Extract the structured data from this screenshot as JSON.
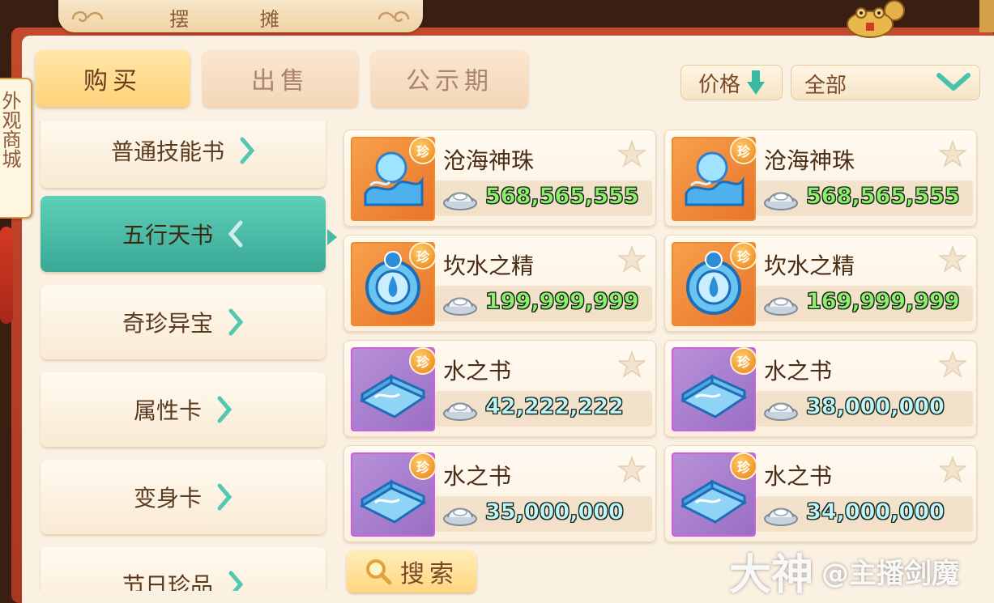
{
  "window": {
    "title": "摆 摊"
  },
  "side_tab": {
    "label": "外观商城"
  },
  "tabs": [
    {
      "label": "购买",
      "active": true
    },
    {
      "label": "出售",
      "active": false
    },
    {
      "label": "公示期",
      "active": false
    }
  ],
  "sort": {
    "label": "价格",
    "direction_icon": "arrow-down-icon"
  },
  "filter": {
    "selected": "全部"
  },
  "categories": [
    {
      "label": "普通技能书",
      "active": false
    },
    {
      "label": "五行天书",
      "active": true
    },
    {
      "label": "奇珍异宝",
      "active": false
    },
    {
      "label": "属性卡",
      "active": false
    },
    {
      "label": "变身卡",
      "active": false
    },
    {
      "label": "节日珍品",
      "active": false
    }
  ],
  "rare_badge": "珍",
  "items": [
    {
      "name": "沧海神珠",
      "price": "568,565,555",
      "icon": "water-orb-icon",
      "frame": "orange",
      "price_color": "green"
    },
    {
      "name": "沧海神珠",
      "price": "568,565,555",
      "icon": "water-orb-icon",
      "frame": "orange",
      "price_color": "green"
    },
    {
      "name": "坎水之精",
      "price": "199,999,999",
      "icon": "water-essence-icon",
      "frame": "orange",
      "price_color": "green"
    },
    {
      "name": "坎水之精",
      "price": "169,999,999",
      "icon": "water-essence-icon",
      "frame": "orange",
      "price_color": "green"
    },
    {
      "name": "水之书",
      "price": "42,222,222",
      "icon": "water-book-icon",
      "frame": "purple",
      "price_color": "cyan"
    },
    {
      "name": "水之书",
      "price": "38,000,000",
      "icon": "water-book-icon",
      "frame": "purple",
      "price_color": "cyan"
    },
    {
      "name": "水之书",
      "price": "35,000,000",
      "icon": "water-book-icon",
      "frame": "purple",
      "price_color": "cyan"
    },
    {
      "name": "水之书",
      "price": "34,000,000",
      "icon": "water-book-icon",
      "frame": "purple",
      "price_color": "cyan"
    }
  ],
  "search": {
    "label": "搜索"
  },
  "watermark": {
    "brand": "大神",
    "handle": "@主播剑魔"
  },
  "colors": {
    "accent_teal": "#47b9a5",
    "frame_red": "#b23e23",
    "price_green": "#8cf06a",
    "price_cyan": "#bff5ff"
  }
}
